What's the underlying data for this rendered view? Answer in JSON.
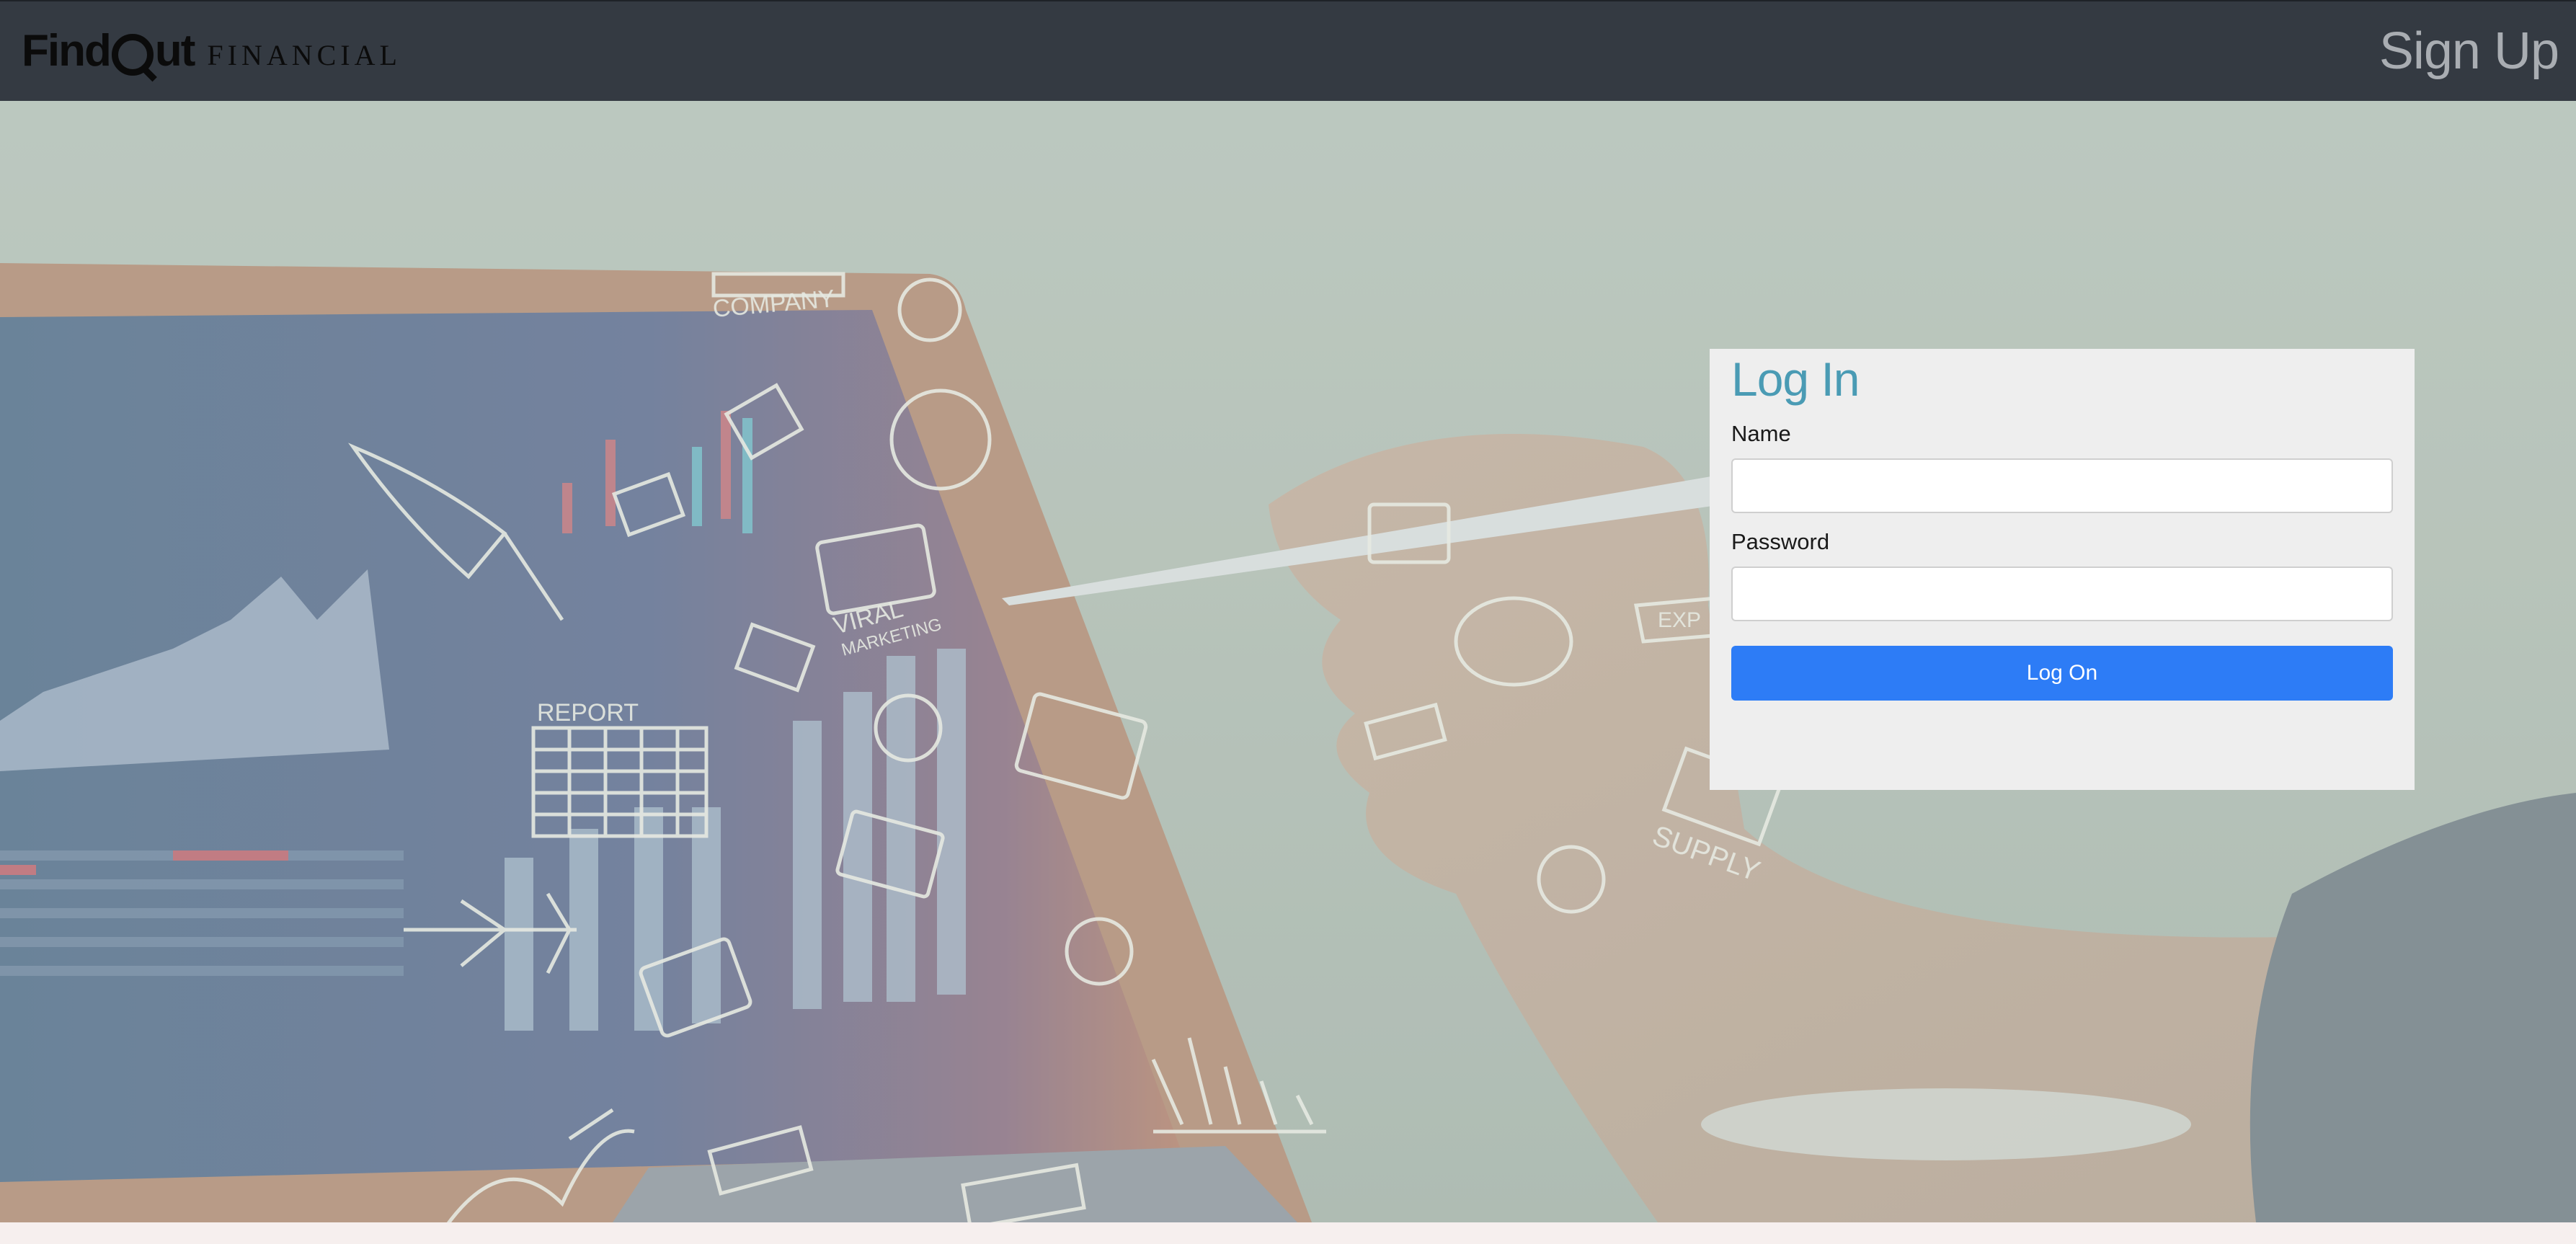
{
  "header": {
    "logo_find": "Find",
    "logo_out": "ut",
    "logo_financial": "FINANCIAL",
    "signup_label": "Sign Up"
  },
  "login": {
    "title": "Log In",
    "name_label": "Name",
    "name_value": "",
    "password_label": "Password",
    "password_value": "",
    "submit_label": "Log On"
  },
  "colors": {
    "topbar": "#343a42",
    "title_accent": "#4a9bb4",
    "button": "#2d7cf6"
  },
  "background_sketch_words": {
    "company": "COMPANY",
    "viral": "VIRAL",
    "marketing": "MARKETING",
    "report": "REPORT",
    "supply": "SUPPLY",
    "exp": "EXP"
  }
}
